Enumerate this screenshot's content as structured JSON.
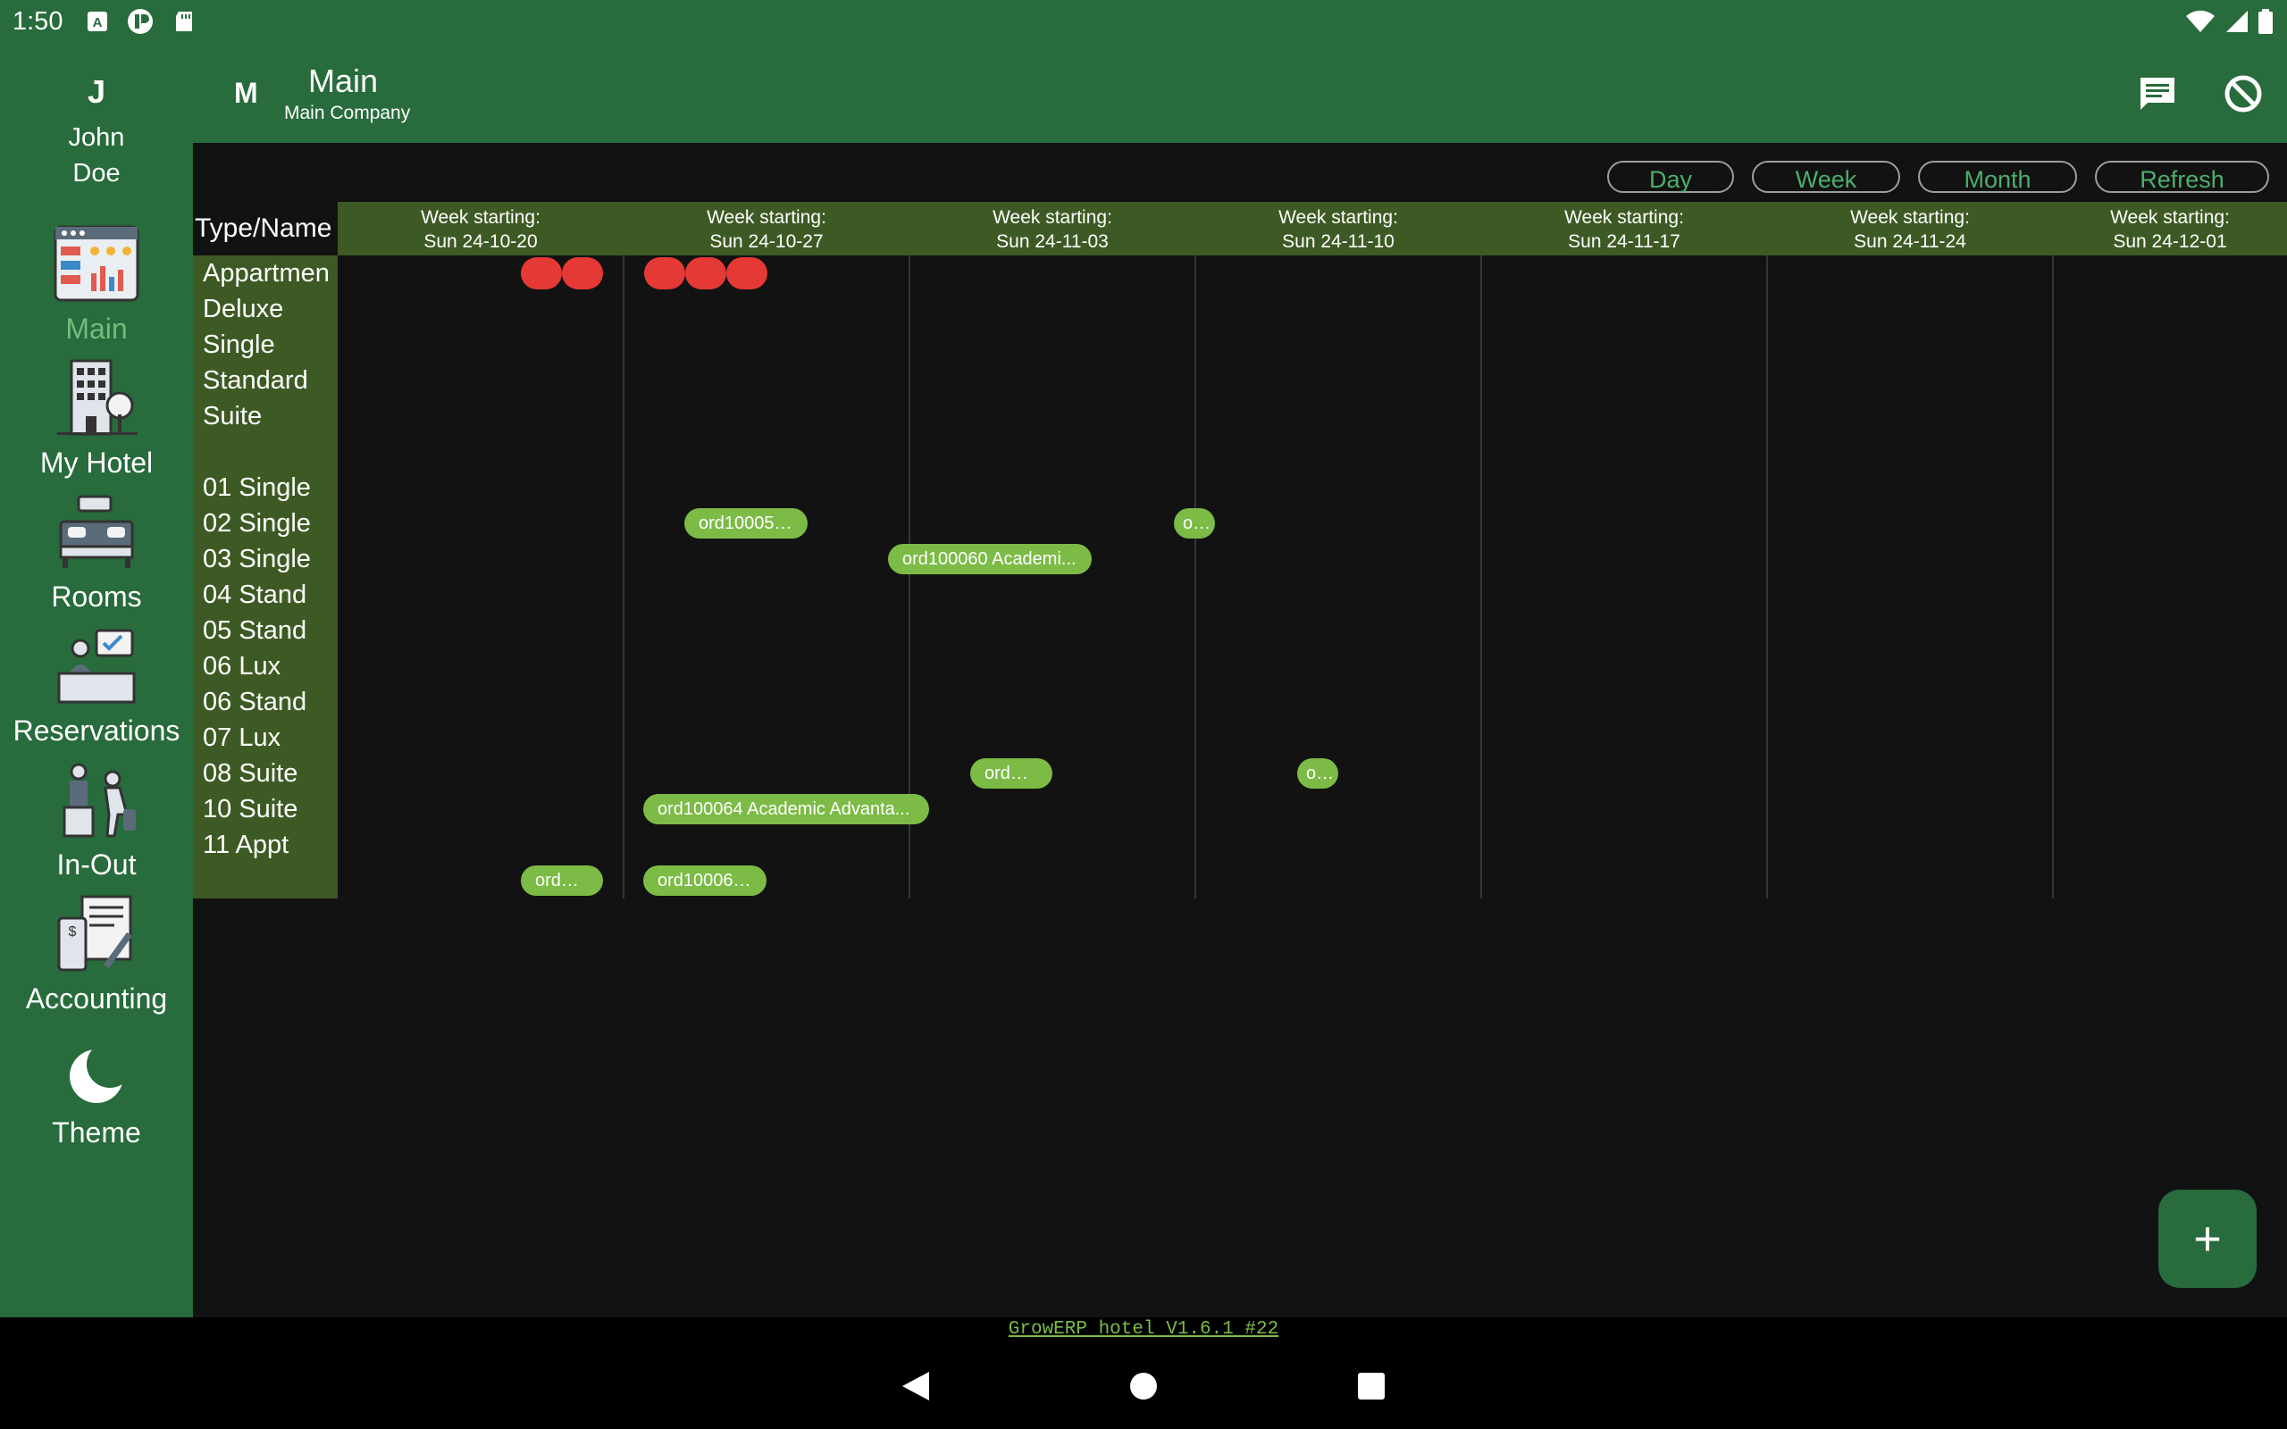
{
  "status": {
    "time": "1:50"
  },
  "appbar": {
    "avatar_letter": "M",
    "title": "Main",
    "subtitle": "Main Company",
    "chat_icon": "chat-icon",
    "block_icon": "block-icon"
  },
  "user": {
    "avatar_letter": "J",
    "name": "John\nDoe"
  },
  "nav": [
    {
      "label": "Main",
      "icon": "dashboard-icon",
      "selected": true
    },
    {
      "label": "My Hotel",
      "icon": "hotel-building-icon",
      "selected": false
    },
    {
      "label": "Rooms",
      "icon": "bed-icon",
      "selected": false
    },
    {
      "label": "Reservations",
      "icon": "reception-desk-icon",
      "selected": false
    },
    {
      "label": "In-Out",
      "icon": "checkin-checkout-icon",
      "selected": false
    },
    {
      "label": "Accounting",
      "icon": "invoice-icon",
      "selected": false
    },
    {
      "label": "Theme",
      "icon": "moon-icon",
      "selected": false
    }
  ],
  "toolbar": {
    "day": "Day",
    "week": "Week",
    "month": "Month",
    "refresh": "Refresh"
  },
  "planner": {
    "type_name_header": "Type/Name",
    "weeks": [
      {
        "l1": "Week starting:",
        "l2": "Sun 24-10-20"
      },
      {
        "l1": "Week starting:",
        "l2": "Sun 24-10-27"
      },
      {
        "l1": "Week starting:",
        "l2": "Sun 24-11-03"
      },
      {
        "l1": "Week starting:",
        "l2": "Sun 24-11-10"
      },
      {
        "l1": "Week starting:",
        "l2": "Sun 24-11-17"
      },
      {
        "l1": "Week starting:",
        "l2": "Sun 24-11-24"
      },
      {
        "l1": "Week starting:",
        "l2": "Sun 24-12-01"
      }
    ],
    "rows": [
      "Appartmen",
      "Deluxe",
      "Single",
      "Standard",
      "Suite",
      "",
      "01 Single",
      "02 Single",
      "03 Single",
      "04 Stand",
      "05 Stand",
      "06 Lux",
      "06 Stand",
      "07 Lux",
      "08 Suite",
      "10 Suite",
      "11 Appt"
    ],
    "chips": [
      {
        "text": "ord100059 ...",
        "row": 6
      },
      {
        "text": "o...",
        "row": 6
      },
      {
        "text": "ord100060  Academi...",
        "row": 7
      },
      {
        "text": "ord10...",
        "row": 13
      },
      {
        "text": "o...",
        "row": 13
      },
      {
        "text": "ord100064  Academic Advanta...",
        "row": 14
      },
      {
        "text": "ord10...",
        "row": 16
      },
      {
        "text": "ord100066 ...",
        "row": 16
      }
    ],
    "occupied_marker_color": "#e53935",
    "reservation_color": "#7cbb46"
  },
  "fab": {
    "label": "+"
  },
  "footer": {
    "version": "GrowERP hotel V1.6.1 #22"
  },
  "colors": {
    "primary": "#286b3c",
    "header": "#3e5a24",
    "background": "#121212"
  }
}
